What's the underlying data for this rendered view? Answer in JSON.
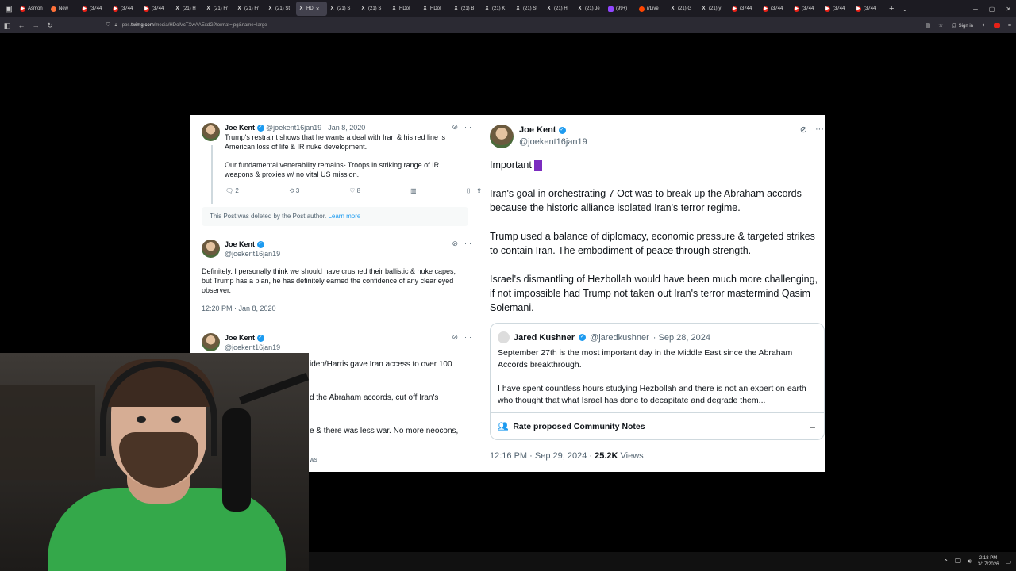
{
  "browser": {
    "tabs": [
      {
        "label": "Asmon",
        "icon": "youtube-icon"
      },
      {
        "label": "New T",
        "icon": "firefox-icon"
      },
      {
        "label": "(3744",
        "icon": "youtube-icon"
      },
      {
        "label": "(3744",
        "icon": "youtube-icon"
      },
      {
        "label": "(3744",
        "icon": "youtube-icon"
      },
      {
        "label": "(21) H",
        "icon": "x-icon"
      },
      {
        "label": "(21) Fr",
        "icon": "x-icon"
      },
      {
        "label": "(21) Fr",
        "icon": "x-icon"
      },
      {
        "label": "(21) St",
        "icon": "x-icon"
      },
      {
        "label": "HD",
        "icon": "x-icon",
        "active": true
      },
      {
        "label": "(21) S",
        "icon": "x-icon"
      },
      {
        "label": "(21) S",
        "icon": "x-icon"
      },
      {
        "label": "HDoI",
        "icon": "x-icon"
      },
      {
        "label": "HDoI",
        "icon": "x-icon"
      },
      {
        "label": "(21) B",
        "icon": "x-icon"
      },
      {
        "label": "(21) K",
        "icon": "x-icon"
      },
      {
        "label": "(21) St",
        "icon": "x-icon"
      },
      {
        "label": "(21) H",
        "icon": "x-icon"
      },
      {
        "label": "(21) Je",
        "icon": "x-icon"
      },
      {
        "label": "(99+)",
        "icon": "twitch-icon"
      },
      {
        "label": "r/Live",
        "icon": "reddit-icon"
      },
      {
        "label": "(21) G",
        "icon": "x-icon"
      },
      {
        "label": "(21) y",
        "icon": "x-icon"
      },
      {
        "label": "(3744",
        "icon": "youtube-icon"
      },
      {
        "label": "(3744",
        "icon": "youtube-icon"
      },
      {
        "label": "(3744",
        "icon": "youtube-icon"
      },
      {
        "label": "(3744",
        "icon": "youtube-icon"
      },
      {
        "label": "(3744",
        "icon": "youtube-icon"
      }
    ],
    "url_prefix": "pbs.",
    "url_domain": "twimg.com",
    "url_path": "/media/HDolVcTXwAAExdG?format=jpg&name=large",
    "signin_label": "Sign in"
  },
  "left_tweets": {
    "first": {
      "name": "Joe Kent",
      "handle": "@joekent16jan19",
      "date": "· Jan 8, 2020",
      "text1": "Trump's restraint shows that he wants a deal with Iran & his red line is American loss of life & IR nuke development.",
      "text2": "Our fundamental venerability remains- Troops in striking range of IR weapons & proxies w/ no vital US mission.",
      "replies": "2",
      "reposts": "3",
      "likes": "8"
    },
    "deleted_notice": "This Post was deleted by the Post author.",
    "learn_more": "Learn more",
    "second": {
      "name": "Joe Kent",
      "handle": "@joekent16jan19",
      "text": "Definitely. I personally think we should have crushed their ballistic & nuke capes, but Trump has a plan, he has definitely earned the confidence of any clear eyed observer.",
      "timestamp": "12:20 PM · Jan 8, 2020"
    },
    "third": {
      "name": "Joe Kent",
      "handle": "@joekent16jan19",
      "line1": "iden/Harris gave Iran access to over 100",
      "line2": "d the Abraham accords, cut off Iran's",
      "line3": "e & there was less war. No more neocons,",
      "line4": "ws"
    }
  },
  "main_tweet": {
    "name": "Joe Kent",
    "handle": "@joekent16jan19",
    "p0": "Important",
    "p1": "Iran's goal in orchestrating 7 Oct was to break up the Abraham accords because the historic alliance isolated Iran's terror regime.",
    "p2": "Trump used a balance of diplomacy, economic pressure & targeted strikes to contain Iran. The embodiment of peace through strength.",
    "p3": "Israel's dismantling of Hezbollah would have been much more challenging, if not impossible had Trump not taken out Iran's terror mastermind Qasim Solemani.",
    "quote": {
      "name": "Jared Kushner",
      "handle": "@jaredkushner",
      "date": "· Sep 28, 2024",
      "p1": "September 27th is the most important day in the Middle East since the Abraham Accords breakthrough.",
      "p2": "I have spent countless hours studying Hezbollah and there is not an expert on earth who thought that what Israel has done to decapitate and degrade them...",
      "notes_label": "Rate proposed Community Notes"
    },
    "timestamp": "12:16 PM · Sep 29, 2024 ·",
    "views_count": "25.2K",
    "views_label": "Views"
  },
  "taskbar": {
    "time": "2:18 PM",
    "date": "3/17/2026"
  }
}
